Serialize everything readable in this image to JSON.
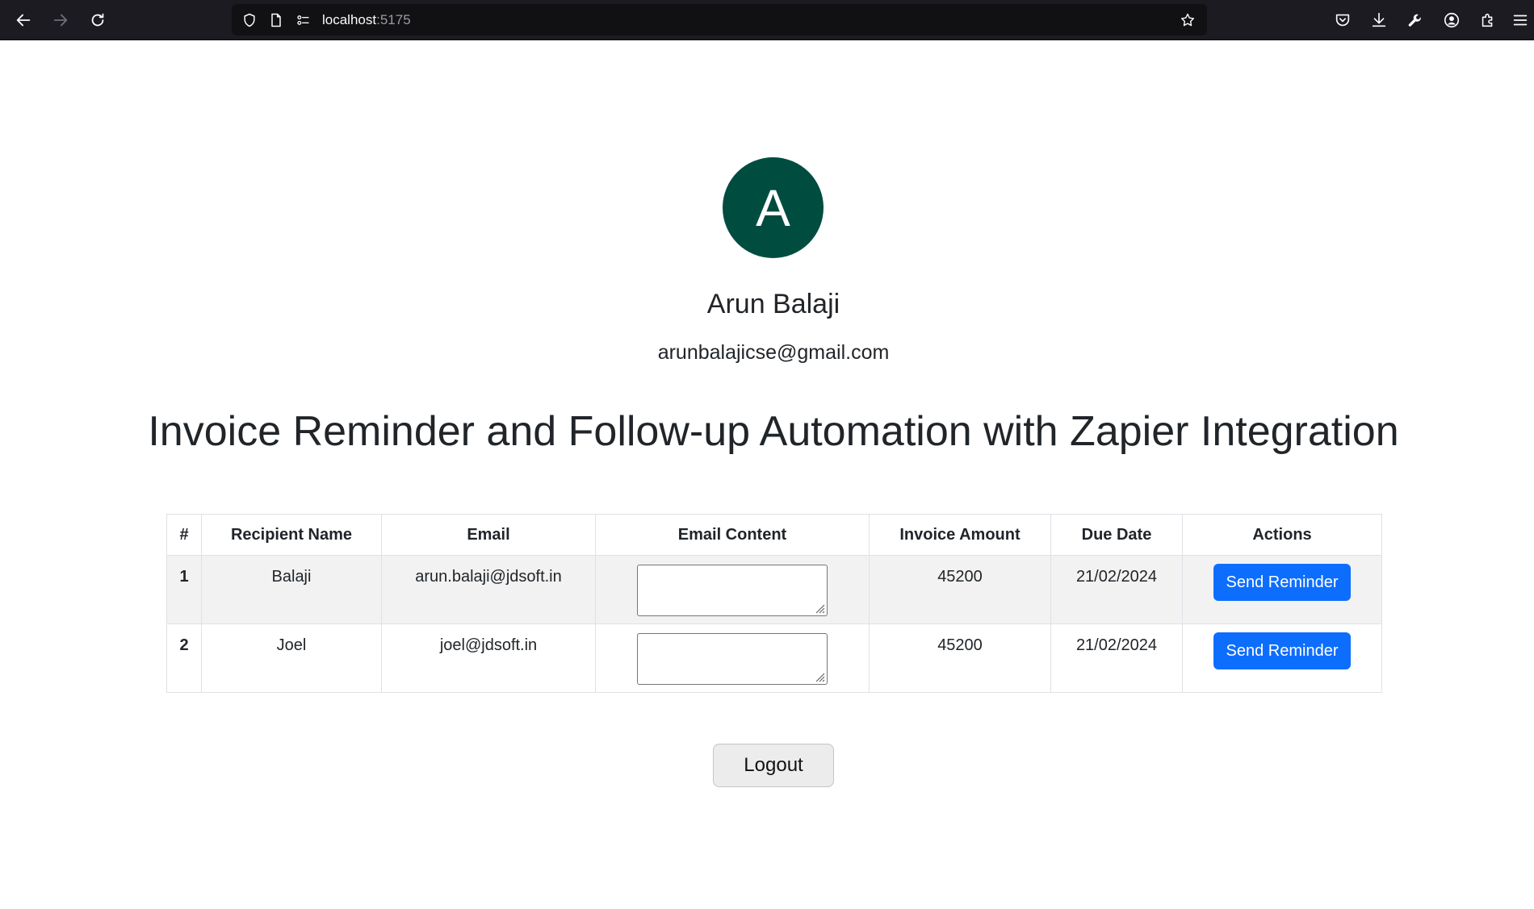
{
  "browser": {
    "url_host": "localhost",
    "url_port": ":5175"
  },
  "profile": {
    "avatar_initial": "A",
    "avatar_color": "#004d40",
    "name": "Arun Balaji",
    "email": "arunbalajicse@gmail.com"
  },
  "page": {
    "title": "Invoice Reminder and Follow-up Automation with Zapier Integration"
  },
  "table": {
    "headers": [
      "#",
      "Recipient Name",
      "Email",
      "Email Content",
      "Invoice Amount",
      "Due Date",
      "Actions"
    ],
    "rows": [
      {
        "num": "1",
        "name": "Balaji",
        "email": "arun.balaji@jdsoft.in",
        "content": "",
        "amount": "45200",
        "due": "21/02/2024",
        "action": "Send Reminder"
      },
      {
        "num": "2",
        "name": "Joel",
        "email": "joel@jdsoft.in",
        "content": "",
        "amount": "45200",
        "due": "21/02/2024",
        "action": "Send Reminder"
      }
    ]
  },
  "logout_label": "Logout",
  "colors": {
    "primary_button": "#0d6efd",
    "toolbar_bg": "#1c1b22"
  },
  "icons": [
    "back-icon",
    "forward-icon",
    "reload-icon",
    "shield-icon",
    "page-icon",
    "permissions-icon",
    "bookmark-star-icon",
    "pocket-icon",
    "download-icon",
    "wrench-icon",
    "account-icon",
    "extensions-icon",
    "menu-icon"
  ]
}
